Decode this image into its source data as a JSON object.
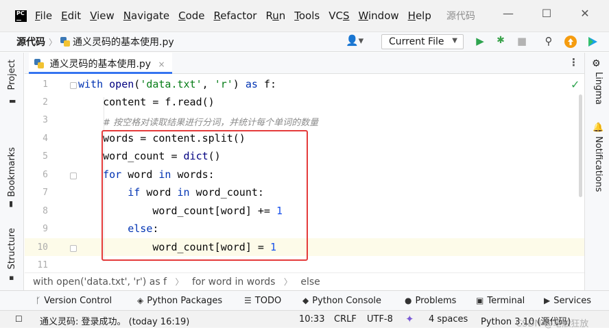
{
  "menu": {
    "logo": "PC",
    "items": [
      {
        "label": "File",
        "mnemonic": "F",
        "rest": "ile"
      },
      {
        "label": "Edit",
        "mnemonic": "E",
        "rest": "dit"
      },
      {
        "label": "View",
        "mnemonic": "V",
        "rest": "iew"
      },
      {
        "label": "Navigate",
        "mnemonic": "N",
        "rest": "avigate"
      },
      {
        "label": "Code",
        "mnemonic": "C",
        "rest": "ode"
      },
      {
        "label": "Refactor",
        "mnemonic": "R",
        "rest": "efactor"
      },
      {
        "label": "Run",
        "mnemonic": "",
        "pre": "R",
        "mid": "u",
        "rest": "n"
      },
      {
        "label": "Tools",
        "mnemonic": "T",
        "rest": "ools"
      },
      {
        "label": "VCS",
        "mnemonic": "",
        "pre": "VC",
        "mid": "S",
        "rest": ""
      },
      {
        "label": "Window",
        "mnemonic": "W",
        "rest": "indow"
      },
      {
        "label": "Help",
        "mnemonic": "H",
        "rest": "elp"
      }
    ],
    "project_name": "源代码",
    "minimize": "—",
    "maximize": "☐",
    "close": "✕"
  },
  "navbar": {
    "root": "源代码",
    "file": "通义灵码的基本使用.py",
    "run_config": "Current File"
  },
  "colors": {
    "run": "#2ea44f",
    "debug": "#3ba34c",
    "update": "#f59c10",
    "highlight_box": "#e43a3a",
    "current_line": "#fdfbe9"
  },
  "left_tabs": [
    "Project",
    "Bookmarks",
    "Structure"
  ],
  "right_tabs": [
    "Lingma",
    "Notifications"
  ],
  "editor_tab": {
    "label": "通义灵码的基本使用.py",
    "close": "×"
  },
  "code": {
    "line_numbers": [
      "1",
      "2",
      "3",
      "4",
      "5",
      "6",
      "7",
      "8",
      "9",
      "10",
      "11"
    ],
    "comment": "# 按空格对读取结果进行分词，并统计每个单词的数量"
  },
  "breadcrumb": [
    "with open('data.txt', 'r') as f",
    "for word in words",
    "else"
  ],
  "tool_windows": [
    {
      "label": "Version Control",
      "icon": "branch-icon"
    },
    {
      "label": "Python Packages",
      "icon": "layers-icon"
    },
    {
      "label": "TODO",
      "icon": "list-icon"
    },
    {
      "label": "Python Console",
      "icon": "python-icon"
    },
    {
      "label": "Problems",
      "icon": "warning-icon"
    },
    {
      "label": "Terminal",
      "icon": "terminal-icon"
    },
    {
      "label": "Services",
      "icon": "services-icon"
    }
  ],
  "status": {
    "message": "通义灵码: 登录成功。 (today 16:19)",
    "position": "10:33",
    "line_sep": "CRLF",
    "encoding": "UTF-8",
    "indent": "4 spaces",
    "interpreter": "Python 3.10 (源代码)"
  },
  "watermark": "CSDN @笔触狂放"
}
